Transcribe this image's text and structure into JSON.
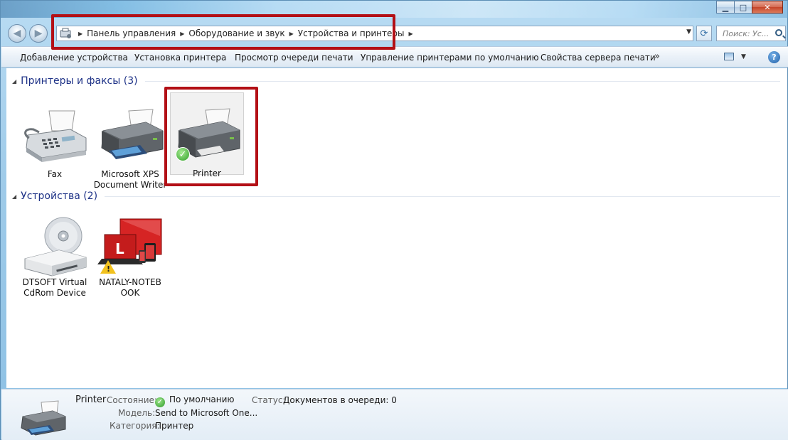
{
  "window": {
    "minimize_glyph": "▁",
    "maximize_glyph": "□",
    "close_glyph": "✕"
  },
  "nav": {
    "back_glyph": "◀",
    "forward_glyph": "▶",
    "breadcrumb": [
      "Панель управления",
      "Оборудование и звук",
      "Устройства и принтеры"
    ],
    "search_placeholder": "Поиск: Ус..."
  },
  "commands": {
    "add_device": "Добавление устройства",
    "install_printer": "Установка принтера",
    "view_queue": "Просмотр очереди печати",
    "manage_default": "Управление принтерами по умолчанию",
    "server_props": "Свойства сервера печати",
    "more": "»",
    "help": "?"
  },
  "groups": {
    "printers": {
      "title": "Принтеры и факсы (3)",
      "items": [
        {
          "label_line1": "Fax",
          "label_line2": ""
        },
        {
          "label_line1": "Microsoft XPS",
          "label_line2": "Document Writer"
        },
        {
          "label_line1": "Printer",
          "label_line2": ""
        }
      ]
    },
    "devices": {
      "title": "Устройства (2)",
      "items": [
        {
          "label_line1": "DTSOFT Virtual",
          "label_line2": "CdRom Device"
        },
        {
          "label_line1": "NATALY-NOTEB",
          "label_line2": "OOK"
        }
      ]
    }
  },
  "details": {
    "name": "Printer",
    "state_label": "Состояние:",
    "state_value": "По умолчанию",
    "status_label": "Статус:",
    "status_value": "Документов в очереди: 0",
    "model_label": "Модель:",
    "model_value": "Send to Microsoft One...",
    "category_label": "Категория:",
    "category_value": "Принтер"
  },
  "colors": {
    "highlight_red": "#b31016",
    "group_title": "#1e3287"
  },
  "icons": [
    "fax-icon",
    "printer-icon",
    "check-icon",
    "cdrom-drive-icon",
    "laptop-icon",
    "warning-icon",
    "help-icon",
    "view-icon"
  ]
}
